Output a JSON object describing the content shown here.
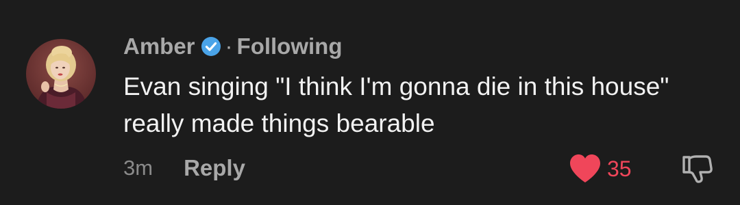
{
  "comment": {
    "author": {
      "name": "Amber",
      "verified": true,
      "separator": "·",
      "relationship": "Following",
      "avatar_icon": "profile-avatar"
    },
    "text": "Evan singing \"I think I'm gonna die in this house\" really made things bearable",
    "timestamp": "3m",
    "reply_label": "Reply",
    "likes": {
      "count": "35",
      "liked": true,
      "icon": "heart-icon"
    },
    "dislike_icon": "thumbs-down-icon"
  },
  "colors": {
    "background": "#1c1c1c",
    "muted_text": "#a8a8a8",
    "body_text": "#f2f2f2",
    "verified_badge": "#4aa3e8",
    "like": "#f0465a"
  }
}
